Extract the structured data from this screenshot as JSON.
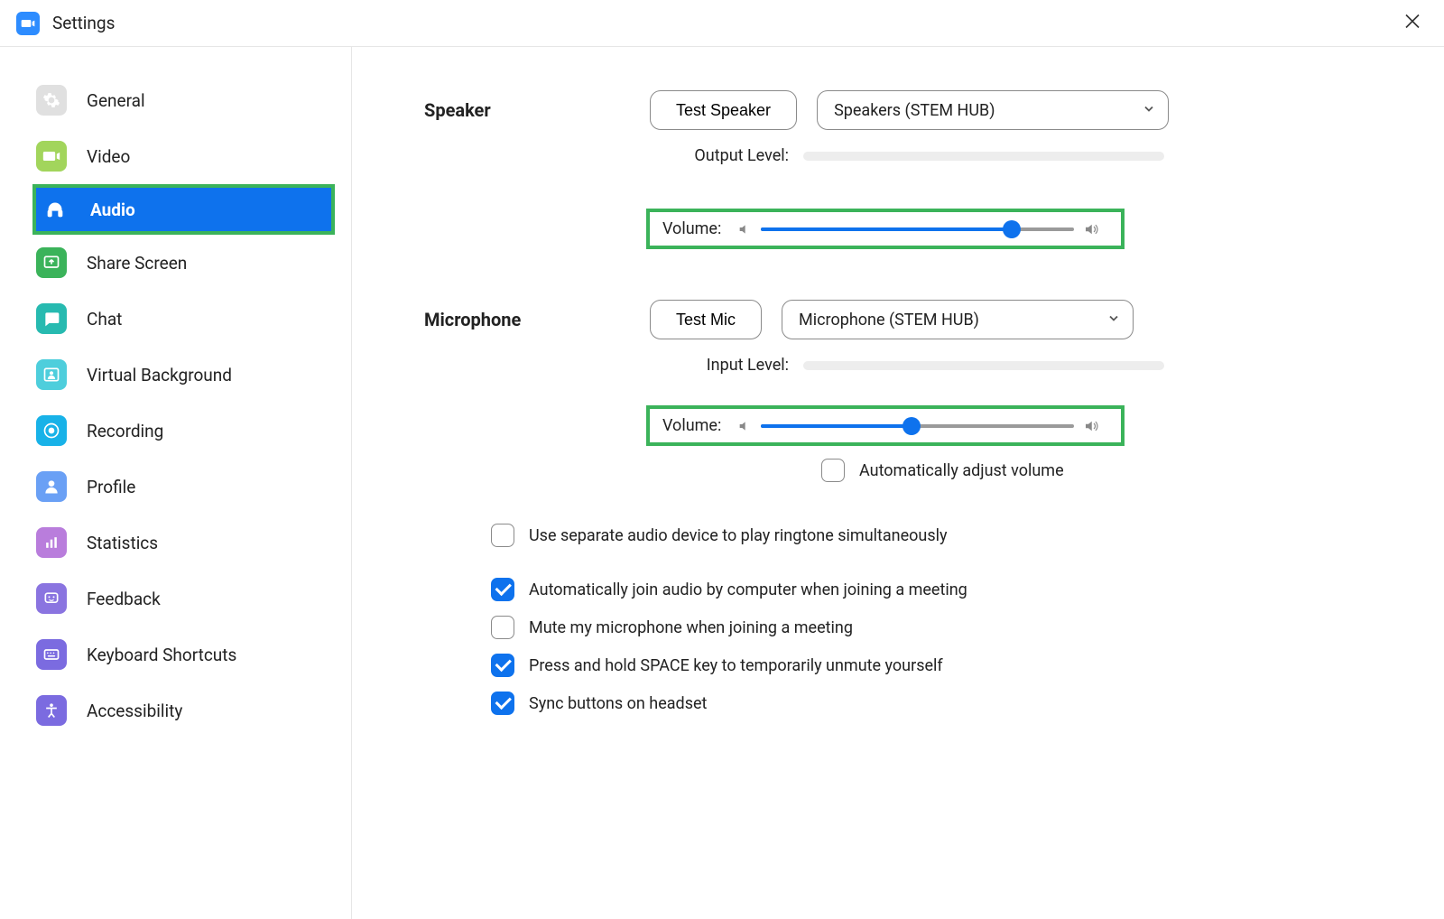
{
  "titlebar": {
    "title": "Settings"
  },
  "sidebar": {
    "items": [
      {
        "label": "General",
        "icon": "gear-icon",
        "color": "#e0e0e0"
      },
      {
        "label": "Video",
        "icon": "video-icon",
        "color": "#a2d55c"
      },
      {
        "label": "Audio",
        "icon": "headphones-icon",
        "color": "#0e72ed",
        "active": true
      },
      {
        "label": "Share Screen",
        "icon": "share-screen-icon",
        "color": "#3bb35a"
      },
      {
        "label": "Chat",
        "icon": "chat-icon",
        "color": "#27bab0"
      },
      {
        "label": "Virtual Background",
        "icon": "virtual-background-icon",
        "color": "#4ecedc"
      },
      {
        "label": "Recording",
        "icon": "recording-icon",
        "color": "#18b2e8"
      },
      {
        "label": "Profile",
        "icon": "profile-icon",
        "color": "#6aa0f5"
      },
      {
        "label": "Statistics",
        "icon": "statistics-icon",
        "color": "#b97ddc"
      },
      {
        "label": "Feedback",
        "icon": "feedback-icon",
        "color": "#8a74e0"
      },
      {
        "label": "Keyboard Shortcuts",
        "icon": "keyboard-icon",
        "color": "#7b6be0"
      },
      {
        "label": "Accessibility",
        "icon": "accessibility-icon",
        "color": "#7b6be0"
      }
    ]
  },
  "audio": {
    "speaker": {
      "label": "Speaker",
      "test_label": "Test Speaker",
      "device": "Speakers (STEM HUB)",
      "output_level_label": "Output Level:",
      "volume_label": "Volume:",
      "volume_percent": 80
    },
    "microphone": {
      "label": "Microphone",
      "test_label": "Test Mic",
      "device": "Microphone (STEM HUB)",
      "input_level_label": "Input Level:",
      "volume_label": "Volume:",
      "volume_percent": 48,
      "auto_adjust_label": "Automatically adjust volume",
      "auto_adjust_checked": false
    },
    "options": [
      {
        "label": "Use separate audio device to play ringtone simultaneously",
        "checked": false
      },
      {
        "label": "Automatically join audio by computer when joining a meeting",
        "checked": true
      },
      {
        "label": "Mute my microphone when joining a meeting",
        "checked": false
      },
      {
        "label": "Press and hold SPACE key to temporarily unmute yourself",
        "checked": true
      },
      {
        "label": "Sync buttons on headset",
        "checked": true
      }
    ]
  }
}
